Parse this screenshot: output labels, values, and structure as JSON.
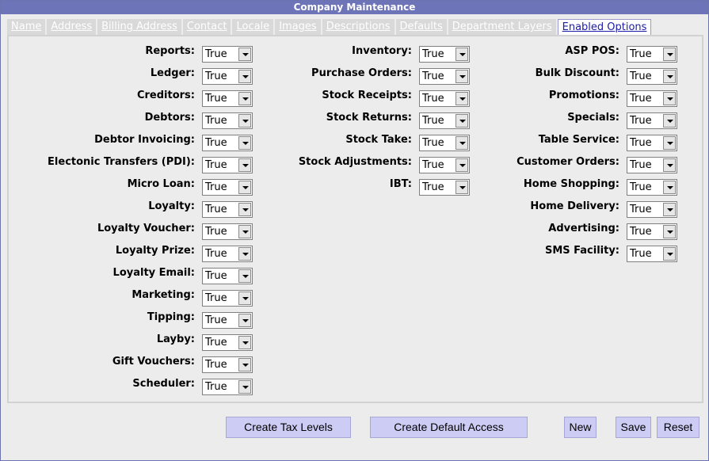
{
  "window": {
    "title": "Company Maintenance"
  },
  "tabs": [
    {
      "label": "Name"
    },
    {
      "label": "Address"
    },
    {
      "label": "Billing Address"
    },
    {
      "label": "Contact"
    },
    {
      "label": "Locale"
    },
    {
      "label": "Images"
    },
    {
      "label": "Descriptions"
    },
    {
      "label": "Defaults"
    },
    {
      "label": "Department Layers"
    },
    {
      "label": "Enabled Options"
    }
  ],
  "active_tab": "Enabled Options",
  "columns": [
    [
      {
        "label": "Reports:",
        "value": "True"
      },
      {
        "label": "Ledger:",
        "value": "True"
      },
      {
        "label": "Creditors:",
        "value": "True"
      },
      {
        "label": "Debtors:",
        "value": "True"
      },
      {
        "label": "Debtor Invoicing:",
        "value": "True"
      },
      {
        "label": "Electonic Transfers (PDI):",
        "value": "True"
      },
      {
        "label": "Micro Loan:",
        "value": "True"
      },
      {
        "label": "Loyalty:",
        "value": "True"
      },
      {
        "label": "Loyalty Voucher:",
        "value": "True"
      },
      {
        "label": "Loyalty Prize:",
        "value": "True"
      },
      {
        "label": "Loyalty Email:",
        "value": "True"
      },
      {
        "label": "Marketing:",
        "value": "True"
      },
      {
        "label": "Tipping:",
        "value": "True"
      },
      {
        "label": "Layby:",
        "value": "True"
      },
      {
        "label": "Gift Vouchers:",
        "value": "True"
      },
      {
        "label": "Scheduler:",
        "value": "True"
      }
    ],
    [
      {
        "label": "Inventory:",
        "value": "True"
      },
      {
        "label": "Purchase Orders:",
        "value": "True"
      },
      {
        "label": "Stock Receipts:",
        "value": "True"
      },
      {
        "label": "Stock Returns:",
        "value": "True"
      },
      {
        "label": "Stock Take:",
        "value": "True"
      },
      {
        "label": "Stock Adjustments:",
        "value": "True"
      },
      {
        "label": "IBT:",
        "value": "True"
      }
    ],
    [
      {
        "label": "ASP POS:",
        "value": "True"
      },
      {
        "label": "Bulk Discount:",
        "value": "True"
      },
      {
        "label": "Promotions:",
        "value": "True"
      },
      {
        "label": "Specials:",
        "value": "True"
      },
      {
        "label": "Table Service:",
        "value": "True"
      },
      {
        "label": "Customer Orders:",
        "value": "True"
      },
      {
        "label": "Home Shopping:",
        "value": "True"
      },
      {
        "label": "Home Delivery:",
        "value": "True"
      },
      {
        "label": "Advertising:",
        "value": "True"
      },
      {
        "label": "SMS Facility:",
        "value": "True"
      }
    ]
  ],
  "buttons": {
    "create_tax_levels": "Create Tax Levels",
    "create_default_access": "Create Default Access",
    "new": "New",
    "save": "Save",
    "reset": "Reset"
  }
}
